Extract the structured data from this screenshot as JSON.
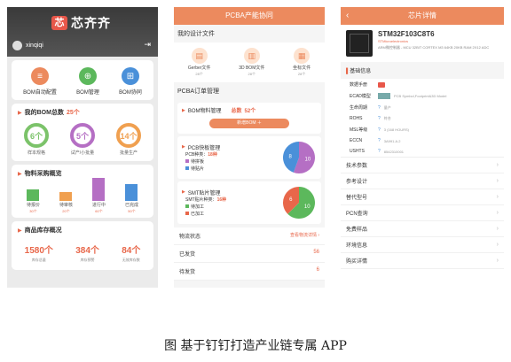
{
  "app": {
    "logo_badge": "芯",
    "logo_text": "芯齐齐",
    "username": "xinqiqi",
    "exit_icon": "⇥"
  },
  "tools": [
    {
      "label": "BOM自动配置",
      "color": "#ec8a5e",
      "icon": "≡"
    },
    {
      "label": "BOM管理",
      "color": "#5cb85c",
      "icon": "⊕"
    },
    {
      "label": "BOM协同",
      "color": "#4a90d9",
      "icon": "⊞"
    }
  ],
  "bom_total": {
    "title": "我的BOM总数",
    "count": "25个",
    "rings": [
      {
        "value": "6个",
        "label": "样本规格",
        "color": "#7cc36a"
      },
      {
        "value": "5个",
        "label": "试产/小批量",
        "color": "#b56fc4"
      },
      {
        "value": "14个",
        "label": "批量生产",
        "color": "#f0a050"
      }
    ]
  },
  "purchase": {
    "title": "物料采购概览",
    "bars": [
      {
        "label": "待报价",
        "value": "30个",
        "color": "#5cb85c",
        "level": 0.5
      },
      {
        "label": "待审核",
        "value": "20个",
        "color": "#f0a050",
        "level": 0.38
      },
      {
        "label": "进行中",
        "value": "60个",
        "color": "#b56fc4",
        "level": 1.0
      },
      {
        "label": "已完成",
        "value": "50个",
        "color": "#4a90d9",
        "level": 0.72
      }
    ]
  },
  "inventory": {
    "title": "商品库存概况",
    "stats": [
      {
        "value": "1580个",
        "label": "库存总量"
      },
      {
        "value": "384个",
        "label": "库存预警"
      },
      {
        "value": "84个",
        "label": "无效库存数"
      }
    ]
  },
  "pcba": {
    "title": "PCBA产能协同",
    "back": "‹",
    "design_title": "我的设计文件",
    "files": [
      {
        "label": "Gerber文件",
        "count": "28个",
        "icon": "▤"
      },
      {
        "label": "3D BOM文件",
        "count": "28个",
        "icon": "▥"
      },
      {
        "label": "坐标文件",
        "count": "28个",
        "icon": "▦"
      }
    ],
    "order_title": "PCBA订单管理",
    "bom_mgmt": {
      "label": "BOM物料管理",
      "count_label": "总数",
      "count": "52个",
      "button": "新增BOM ＋"
    },
    "pcb": {
      "title": "PCB快板管理",
      "kind_label": "PCB种类：",
      "kind": "18种",
      "legend": [
        "待拼板",
        "待贴片"
      ],
      "colors": [
        "#b56fc4",
        "#4a90d9"
      ],
      "values": [
        10,
        8
      ]
    },
    "smt": {
      "title": "SMT贴片管理",
      "kind_label": "SMT贴片种类：",
      "kind": "16种",
      "legend": [
        "待加工",
        "已加工"
      ],
      "colors": [
        "#5cb85c",
        "#e8674a"
      ],
      "values": [
        10,
        6
      ]
    },
    "logistics": {
      "title": "物流状态",
      "link": "查看物流详情 ›",
      "rows": [
        {
          "label": "已发货",
          "value": "56"
        },
        {
          "label": "待发货",
          "value": "6"
        }
      ]
    }
  },
  "chip": {
    "title": "芯片详情",
    "back": "‹",
    "name": "STM32F103C8T6",
    "maker": "STMicroelectronics",
    "desc": "ARM微控制器 - MCU 32BIT CORTEX M3 64KB 20KB RAM 2X12 ADC",
    "basic_title": "基础信息",
    "basic": [
      {
        "key": "数据手册",
        "kind": "pdf",
        "value": ""
      },
      {
        "key": "ECAD模型",
        "kind": "img",
        "value": "PCB Symbol,Footprint&3D Model"
      },
      {
        "key": "生命周期",
        "kind": "q",
        "value": "量产"
      },
      {
        "key": "ROHS",
        "kind": "q",
        "value": "符合"
      },
      {
        "key": "MSL等级",
        "kind": "q",
        "value": "3 (168 HOURS)"
      },
      {
        "key": "ECCN",
        "kind": "q",
        "value": "3A991.A.2"
      },
      {
        "key": "USHTS",
        "kind": "q",
        "value": "8542310001"
      }
    ],
    "menu": [
      "技术参数",
      "参考设计",
      "替代型号",
      "PCN查询",
      "免费样品",
      "环境信息",
      "购买详情"
    ],
    "chevron": "›"
  },
  "caption": "图 基于钉钉打造产业链专属 APP"
}
